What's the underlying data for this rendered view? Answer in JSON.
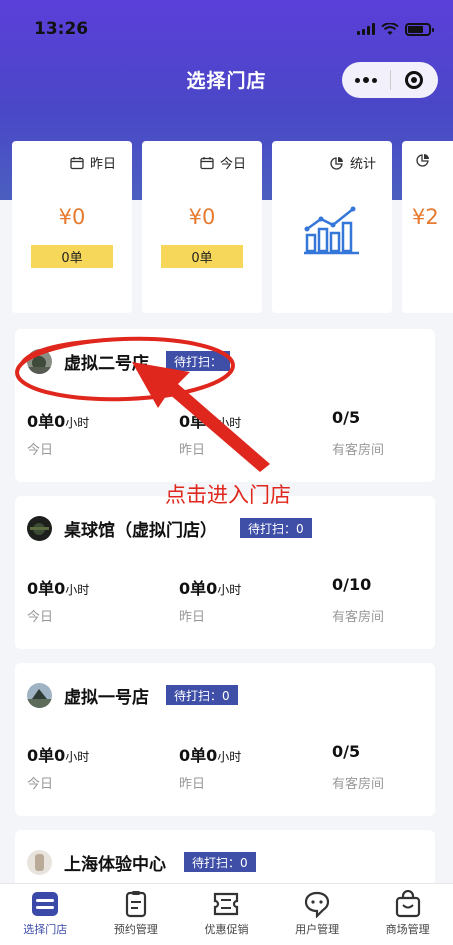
{
  "status_bar": {
    "time": "13:26"
  },
  "header": {
    "title": "选择门店"
  },
  "stat_cards": [
    {
      "label": "昨日",
      "amount": "¥0",
      "orders": "0单",
      "icon": "calendar-icon"
    },
    {
      "label": "今日",
      "amount": "¥0",
      "orders": "0单",
      "icon": "calendar-icon"
    },
    {
      "label": "统计",
      "icon": "pie-chart-icon"
    },
    {
      "label": "",
      "amount": "¥2",
      "icon": "pie-chart-icon"
    }
  ],
  "stores": [
    {
      "name": "虚拟二号店",
      "badge": "待打扫：",
      "orders": "0单0",
      "hours_unit": "小时",
      "orders_y": "0单0",
      "rooms": "0/5",
      "today_label": "今日",
      "yesterday_label": "昨日",
      "rooms_label": "有客房间"
    },
    {
      "name": "桌球馆（虚拟门店）",
      "badge": "待打扫：0",
      "orders": "0单0",
      "hours_unit": "小时",
      "orders_y": "0单0",
      "rooms": "0/10",
      "today_label": "今日",
      "yesterday_label": "昨日",
      "rooms_label": "有客房间"
    },
    {
      "name": "虚拟一号店",
      "badge": "待打扫：0",
      "orders": "0单0",
      "hours_unit": "小时",
      "orders_y": "0单0",
      "rooms": "0/5",
      "today_label": "今日",
      "yesterday_label": "昨日",
      "rooms_label": "有客房间"
    },
    {
      "name": "上海体验中心",
      "badge": "待打扫：0"
    }
  ],
  "annotation": {
    "text": "点击进入门店",
    "color": "#e0271d"
  },
  "tabbar": [
    {
      "label": "选择门店",
      "active": true
    },
    {
      "label": "预约管理"
    },
    {
      "label": "优惠促销"
    },
    {
      "label": "用户管理"
    },
    {
      "label": "商场管理"
    }
  ],
  "colors": {
    "accent": "#3f4fa8",
    "amount": "#e67a2e",
    "orders_bg": "#f7d75a"
  }
}
